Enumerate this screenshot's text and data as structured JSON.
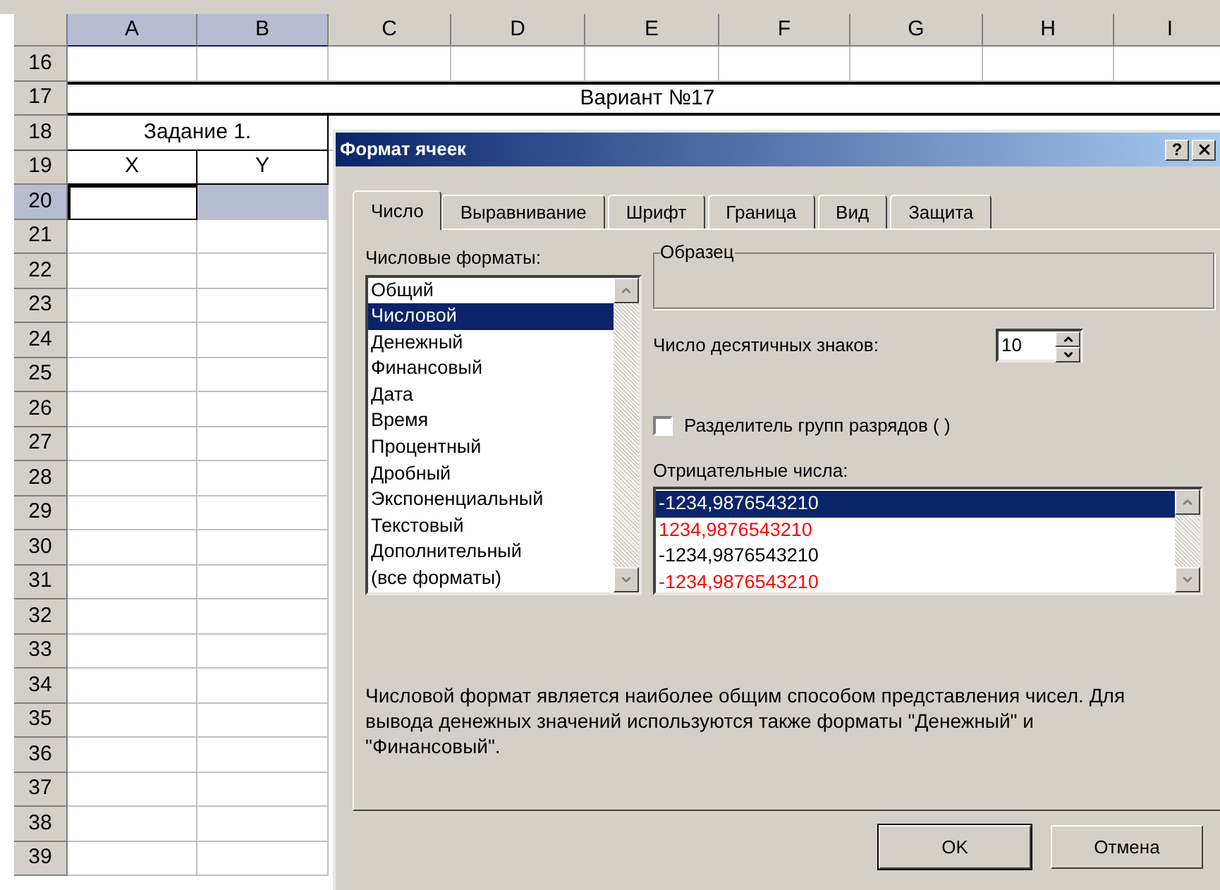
{
  "sheet": {
    "columns": [
      {
        "label": "A",
        "selected": true
      },
      {
        "label": "B",
        "selected": true
      },
      {
        "label": "C",
        "selected": false
      },
      {
        "label": "D",
        "selected": false
      },
      {
        "label": "E",
        "selected": false
      },
      {
        "label": "F",
        "selected": false
      },
      {
        "label": "G",
        "selected": false
      },
      {
        "label": "H",
        "selected": false
      },
      {
        "label": "I",
        "selected": false
      }
    ],
    "rows": [
      {
        "label": "16",
        "selected": false
      },
      {
        "label": "17",
        "selected": false
      },
      {
        "label": "18",
        "selected": false
      },
      {
        "label": "19",
        "selected": false
      },
      {
        "label": "20",
        "selected": true
      },
      {
        "label": "21",
        "selected": false
      },
      {
        "label": "22",
        "selected": false
      },
      {
        "label": "23",
        "selected": false
      },
      {
        "label": "24",
        "selected": false
      },
      {
        "label": "25",
        "selected": false
      },
      {
        "label": "26",
        "selected": false
      },
      {
        "label": "27",
        "selected": false
      },
      {
        "label": "28",
        "selected": false
      },
      {
        "label": "29",
        "selected": false
      },
      {
        "label": "30",
        "selected": false
      },
      {
        "label": "31",
        "selected": false
      },
      {
        "label": "32",
        "selected": false
      },
      {
        "label": "33",
        "selected": false
      },
      {
        "label": "34",
        "selected": false
      },
      {
        "label": "35",
        "selected": false
      },
      {
        "label": "36",
        "selected": false
      },
      {
        "label": "37",
        "selected": false
      },
      {
        "label": "38",
        "selected": false
      },
      {
        "label": "39",
        "selected": false
      }
    ],
    "variant_cell": "Вариант №17",
    "task_cell": "Задание 1.",
    "header_cells": [
      "X",
      "Y"
    ]
  },
  "dialog": {
    "title": "Формат ячеек",
    "help_button": "?",
    "tabs": [
      {
        "label": "Число",
        "selected": true
      },
      {
        "label": "Выравнивание",
        "selected": false
      },
      {
        "label": "Шрифт",
        "selected": false
      },
      {
        "label": "Граница",
        "selected": false
      },
      {
        "label": "Вид",
        "selected": false
      },
      {
        "label": "Защита",
        "selected": false
      }
    ],
    "formats_label": "Числовые форматы:",
    "formats": [
      {
        "label": "Общий",
        "selected": false
      },
      {
        "label": "Числовой",
        "selected": true
      },
      {
        "label": "Денежный",
        "selected": false
      },
      {
        "label": "Финансовый",
        "selected": false
      },
      {
        "label": "Дата",
        "selected": false
      },
      {
        "label": "Время",
        "selected": false
      },
      {
        "label": "Процентный",
        "selected": false
      },
      {
        "label": "Дробный",
        "selected": false
      },
      {
        "label": "Экспоненциальный",
        "selected": false
      },
      {
        "label": "Текстовый",
        "selected": false
      },
      {
        "label": "Дополнительный",
        "selected": false
      },
      {
        "label": "(все форматы)",
        "selected": false
      }
    ],
    "sample_label": "Образец",
    "decimals_label": "Число десятичных знаков:",
    "decimals_value": "10",
    "separator": {
      "label": "Разделитель групп разрядов ( )",
      "checked": false
    },
    "negatives_label": "Отрицательные числа:",
    "negatives": [
      {
        "text": "-1234,9876543210",
        "selected": true
      },
      {
        "text": "1234,9876543210",
        "color": "#ff0000",
        "selected": false
      },
      {
        "text": "-1234,9876543210",
        "color": "#000000",
        "selected": false
      },
      {
        "text": "-1234,9876543210",
        "color": "#ff0000",
        "selected": false
      }
    ],
    "description": "Числовой формат является наиболее общим способом представления чисел. Для вывода денежных значений используются также форматы \"Денежный\" и \"Финансовый\".",
    "buttons": [
      {
        "label": "OK",
        "default": true
      },
      {
        "label": "Отмена",
        "default": false
      }
    ]
  }
}
